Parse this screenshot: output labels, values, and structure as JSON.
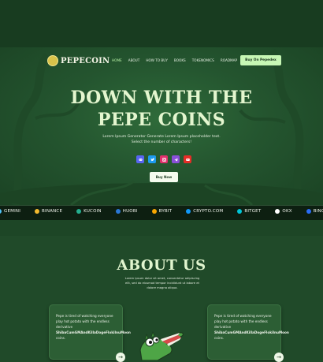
{
  "brand": {
    "name": "PEPECOIN",
    "logo_icon": "coin-icon"
  },
  "nav": {
    "items": [
      "HOME",
      "ABOUT",
      "HOW TO BUY",
      "BOOKS",
      "TOKENOMICS",
      "ROADMAP"
    ],
    "active_index": 0,
    "buy_button": "Buy On Pepedex"
  },
  "hero": {
    "title_line1": "DOWN WITH THE",
    "title_line2": "PEPE COINS",
    "subtitle_line1": "Lorem Ipsum Generator Generate Lorem Ipsum placeholder text.",
    "subtitle_line2": "Select the number of characters!",
    "socials": [
      {
        "name": "discord-icon",
        "color": "#5865f2"
      },
      {
        "name": "twitter-icon",
        "color": "#1d9bf0"
      },
      {
        "name": "instagram-icon",
        "color": "#e1306c"
      },
      {
        "name": "telegram-icon",
        "color": "#8a4fd8"
      },
      {
        "name": "youtube-icon",
        "color": "#e52d27"
      }
    ],
    "buy_button": "Buy Now"
  },
  "ticker": {
    "items": [
      {
        "label": "GEMINI",
        "color": "#4fc3f7"
      },
      {
        "label": "BINANCE",
        "color": "#f3ba2f"
      },
      {
        "label": "KUCOIN",
        "color": "#24ae8f"
      },
      {
        "label": "HUOBI",
        "color": "#2a77d6"
      },
      {
        "label": "BYBIT",
        "color": "#f7a600"
      },
      {
        "label": "CRYPTO.COM",
        "color": "#1199fa"
      },
      {
        "label": "BITGET",
        "color": "#00c4d6"
      },
      {
        "label": "OKX",
        "color": "#ffffff"
      },
      {
        "label": "BINGX APP",
        "color": "#2a6cf6"
      }
    ]
  },
  "about": {
    "title": "ABOUT US",
    "text": "Lorem ipsum dolor sit amet, consectetur adipiscing elit, sed do eiusmod tempor incididunt ut labore et dolore magna aliqua.",
    "cards": [
      {
        "text": "Pepe is tired of watching everyone play hot potato with the endless derivative",
        "highlight": "ShibaCumGMAndKillaDogeFlokiInuMoon",
        "suffix": "coins."
      },
      {
        "text": "Pepe is tired of watching everyone play hot potato with the endless derivative",
        "highlight": "ShibaCumGMAndKillaDogeFlokiInuMoon",
        "suffix": "coins."
      }
    ]
  },
  "colors": {
    "accent": "#c7f7b5",
    "background": "#204a29",
    "title": "#e4f6cf"
  }
}
